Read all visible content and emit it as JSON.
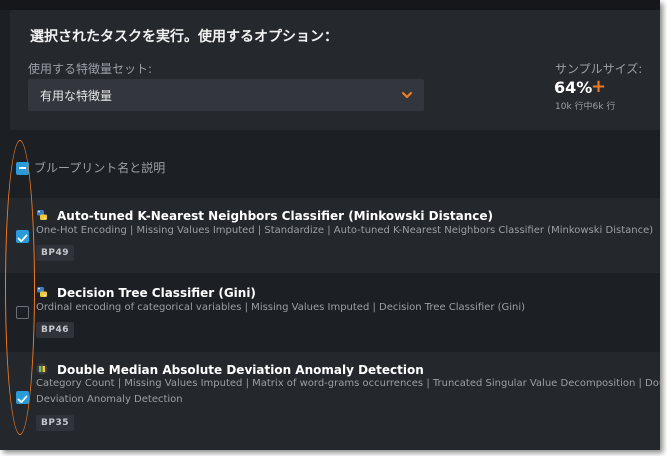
{
  "options": {
    "title": "選択されたタスクを実行。使用するオプション：",
    "feature_list_label": "使用する特徴量セット:",
    "feature_list_value": "有用な特徴量",
    "sample_size_label": "サンプルサイズ:",
    "sample_size_value": "64%",
    "sample_size_plus": "+",
    "sample_size_rows": "10k 行中6k 行"
  },
  "header": {
    "label": "ブループリント名と説明",
    "select_all_state": "partial"
  },
  "blueprints": [
    {
      "title": "Auto-tuned K-Nearest Neighbors Classifier (Minkowski Distance)",
      "description_lines": [
        "One-Hot Encoding | Missing Values Imputed | Standardize | Auto-tuned K-Nearest Neighbors Classifier (Minkowski Distance)"
      ],
      "badge": "BP49",
      "checked": true,
      "icon": "python-icon"
    },
    {
      "title": "Decision Tree Classifier (Gini)",
      "description_lines": [
        "Ordinal encoding of categorical variables | Missing Values Imputed | Decision Tree Classifier (Gini)"
      ],
      "badge": "BP46",
      "checked": false,
      "icon": "python-icon"
    },
    {
      "title": "Double Median Absolute Deviation Anomaly Detection",
      "description_lines": [
        "Category Count | Missing Values Imputed | Matrix of word-grams occurrences | Truncated Singular Value Decomposition | Double Median Absolute",
        "Deviation Anomaly Detection"
      ],
      "badge": "BP35",
      "checked": true,
      "icon": "datarobot-icon"
    }
  ],
  "colors": {
    "accent_orange": "#f07b22",
    "checkbox_blue": "#2a9bd8",
    "background": "#1c1f24",
    "panel": "#25282d"
  }
}
